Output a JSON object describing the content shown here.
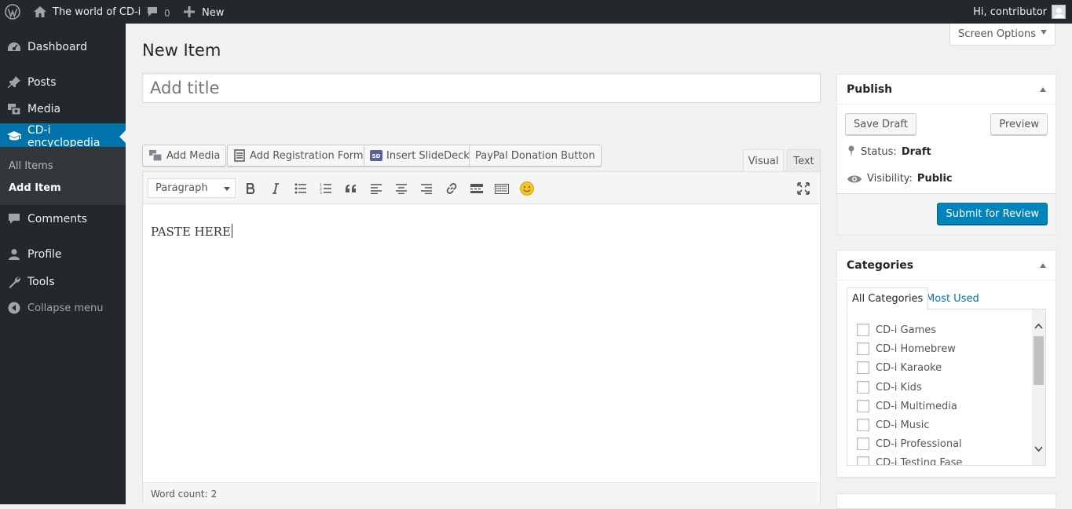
{
  "adminbar": {
    "site_name": "The world of CD-i",
    "comments_count": "0",
    "new_label": "New",
    "greeting": "Hi, contributor"
  },
  "sidebar": {
    "items": [
      {
        "label": "Dashboard",
        "icon": "dashboard-icon"
      },
      {
        "label": "Posts",
        "icon": "pin-icon"
      },
      {
        "label": "Media",
        "icon": "media-icon"
      },
      {
        "label": "CD-i encyclopedia",
        "icon": "graduation-cap-icon"
      },
      {
        "label": "Comments",
        "icon": "comment-icon"
      },
      {
        "label": "Profile",
        "icon": "user-icon"
      },
      {
        "label": "Tools",
        "icon": "wrench-icon"
      }
    ],
    "submenu": [
      "All Items",
      "Add Item"
    ],
    "collapse_label": "Collapse menu"
  },
  "screen_options": "Screen Options",
  "page_title": "New Item",
  "title_placeholder": "Add title",
  "media_buttons": [
    "Add Media",
    "Add Registration Form",
    "Insert SlideDeck",
    "PayPal Donation Button"
  ],
  "editor": {
    "tabs": [
      "Visual",
      "Text"
    ],
    "format_value": "Paragraph",
    "content": "PASTE HERE",
    "word_count_label": "Word count:",
    "word_count": "2"
  },
  "publish": {
    "title": "Publish",
    "save_draft": "Save Draft",
    "preview": "Preview",
    "status_label": "Status:",
    "status_value": "Draft",
    "visibility_label": "Visibility:",
    "visibility_value": "Public",
    "submit": "Submit for Review"
  },
  "categories": {
    "title": "Categories",
    "tabs": [
      "All Categories",
      "Most Used"
    ],
    "items": [
      "CD-i Games",
      "CD-i Homebrew",
      "CD-i Karaoke",
      "CD-i Kids",
      "CD-i Multimedia",
      "CD-i Music",
      "CD-i Professional",
      "CD-i Testing Fase"
    ]
  },
  "colors": {
    "admin_dark": "#23282d",
    "accent": "#0073aa",
    "primary_button": "#0085ba"
  }
}
